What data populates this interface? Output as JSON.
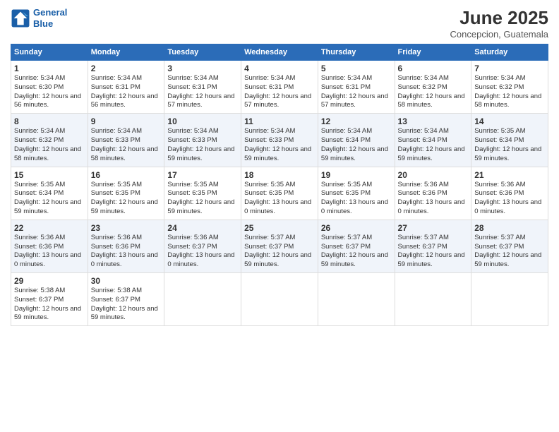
{
  "logo": {
    "line1": "General",
    "line2": "Blue"
  },
  "title": "June 2025",
  "location": "Concepcion, Guatemala",
  "weekdays": [
    "Sunday",
    "Monday",
    "Tuesday",
    "Wednesday",
    "Thursday",
    "Friday",
    "Saturday"
  ],
  "weeks": [
    [
      {
        "day": "1",
        "sunrise": "5:34 AM",
        "sunset": "6:30 PM",
        "daylight": "12 hours and 56 minutes."
      },
      {
        "day": "2",
        "sunrise": "5:34 AM",
        "sunset": "6:31 PM",
        "daylight": "12 hours and 56 minutes."
      },
      {
        "day": "3",
        "sunrise": "5:34 AM",
        "sunset": "6:31 PM",
        "daylight": "12 hours and 57 minutes."
      },
      {
        "day": "4",
        "sunrise": "5:34 AM",
        "sunset": "6:31 PM",
        "daylight": "12 hours and 57 minutes."
      },
      {
        "day": "5",
        "sunrise": "5:34 AM",
        "sunset": "6:31 PM",
        "daylight": "12 hours and 57 minutes."
      },
      {
        "day": "6",
        "sunrise": "5:34 AM",
        "sunset": "6:32 PM",
        "daylight": "12 hours and 58 minutes."
      },
      {
        "day": "7",
        "sunrise": "5:34 AM",
        "sunset": "6:32 PM",
        "daylight": "12 hours and 58 minutes."
      }
    ],
    [
      {
        "day": "8",
        "sunrise": "5:34 AM",
        "sunset": "6:32 PM",
        "daylight": "12 hours and 58 minutes."
      },
      {
        "day": "9",
        "sunrise": "5:34 AM",
        "sunset": "6:33 PM",
        "daylight": "12 hours and 58 minutes."
      },
      {
        "day": "10",
        "sunrise": "5:34 AM",
        "sunset": "6:33 PM",
        "daylight": "12 hours and 59 minutes."
      },
      {
        "day": "11",
        "sunrise": "5:34 AM",
        "sunset": "6:33 PM",
        "daylight": "12 hours and 59 minutes."
      },
      {
        "day": "12",
        "sunrise": "5:34 AM",
        "sunset": "6:34 PM",
        "daylight": "12 hours and 59 minutes."
      },
      {
        "day": "13",
        "sunrise": "5:34 AM",
        "sunset": "6:34 PM",
        "daylight": "12 hours and 59 minutes."
      },
      {
        "day": "14",
        "sunrise": "5:35 AM",
        "sunset": "6:34 PM",
        "daylight": "12 hours and 59 minutes."
      }
    ],
    [
      {
        "day": "15",
        "sunrise": "5:35 AM",
        "sunset": "6:34 PM",
        "daylight": "12 hours and 59 minutes."
      },
      {
        "day": "16",
        "sunrise": "5:35 AM",
        "sunset": "6:35 PM",
        "daylight": "12 hours and 59 minutes."
      },
      {
        "day": "17",
        "sunrise": "5:35 AM",
        "sunset": "6:35 PM",
        "daylight": "12 hours and 59 minutes."
      },
      {
        "day": "18",
        "sunrise": "5:35 AM",
        "sunset": "6:35 PM",
        "daylight": "13 hours and 0 minutes."
      },
      {
        "day": "19",
        "sunrise": "5:35 AM",
        "sunset": "6:35 PM",
        "daylight": "13 hours and 0 minutes."
      },
      {
        "day": "20",
        "sunrise": "5:36 AM",
        "sunset": "6:36 PM",
        "daylight": "13 hours and 0 minutes."
      },
      {
        "day": "21",
        "sunrise": "5:36 AM",
        "sunset": "6:36 PM",
        "daylight": "13 hours and 0 minutes."
      }
    ],
    [
      {
        "day": "22",
        "sunrise": "5:36 AM",
        "sunset": "6:36 PM",
        "daylight": "13 hours and 0 minutes."
      },
      {
        "day": "23",
        "sunrise": "5:36 AM",
        "sunset": "6:36 PM",
        "daylight": "13 hours and 0 minutes."
      },
      {
        "day": "24",
        "sunrise": "5:36 AM",
        "sunset": "6:37 PM",
        "daylight": "13 hours and 0 minutes."
      },
      {
        "day": "25",
        "sunrise": "5:37 AM",
        "sunset": "6:37 PM",
        "daylight": "12 hours and 59 minutes."
      },
      {
        "day": "26",
        "sunrise": "5:37 AM",
        "sunset": "6:37 PM",
        "daylight": "12 hours and 59 minutes."
      },
      {
        "day": "27",
        "sunrise": "5:37 AM",
        "sunset": "6:37 PM",
        "daylight": "12 hours and 59 minutes."
      },
      {
        "day": "28",
        "sunrise": "5:37 AM",
        "sunset": "6:37 PM",
        "daylight": "12 hours and 59 minutes."
      }
    ],
    [
      {
        "day": "29",
        "sunrise": "5:38 AM",
        "sunset": "6:37 PM",
        "daylight": "12 hours and 59 minutes."
      },
      {
        "day": "30",
        "sunrise": "5:38 AM",
        "sunset": "6:37 PM",
        "daylight": "12 hours and 59 minutes."
      },
      null,
      null,
      null,
      null,
      null
    ]
  ]
}
